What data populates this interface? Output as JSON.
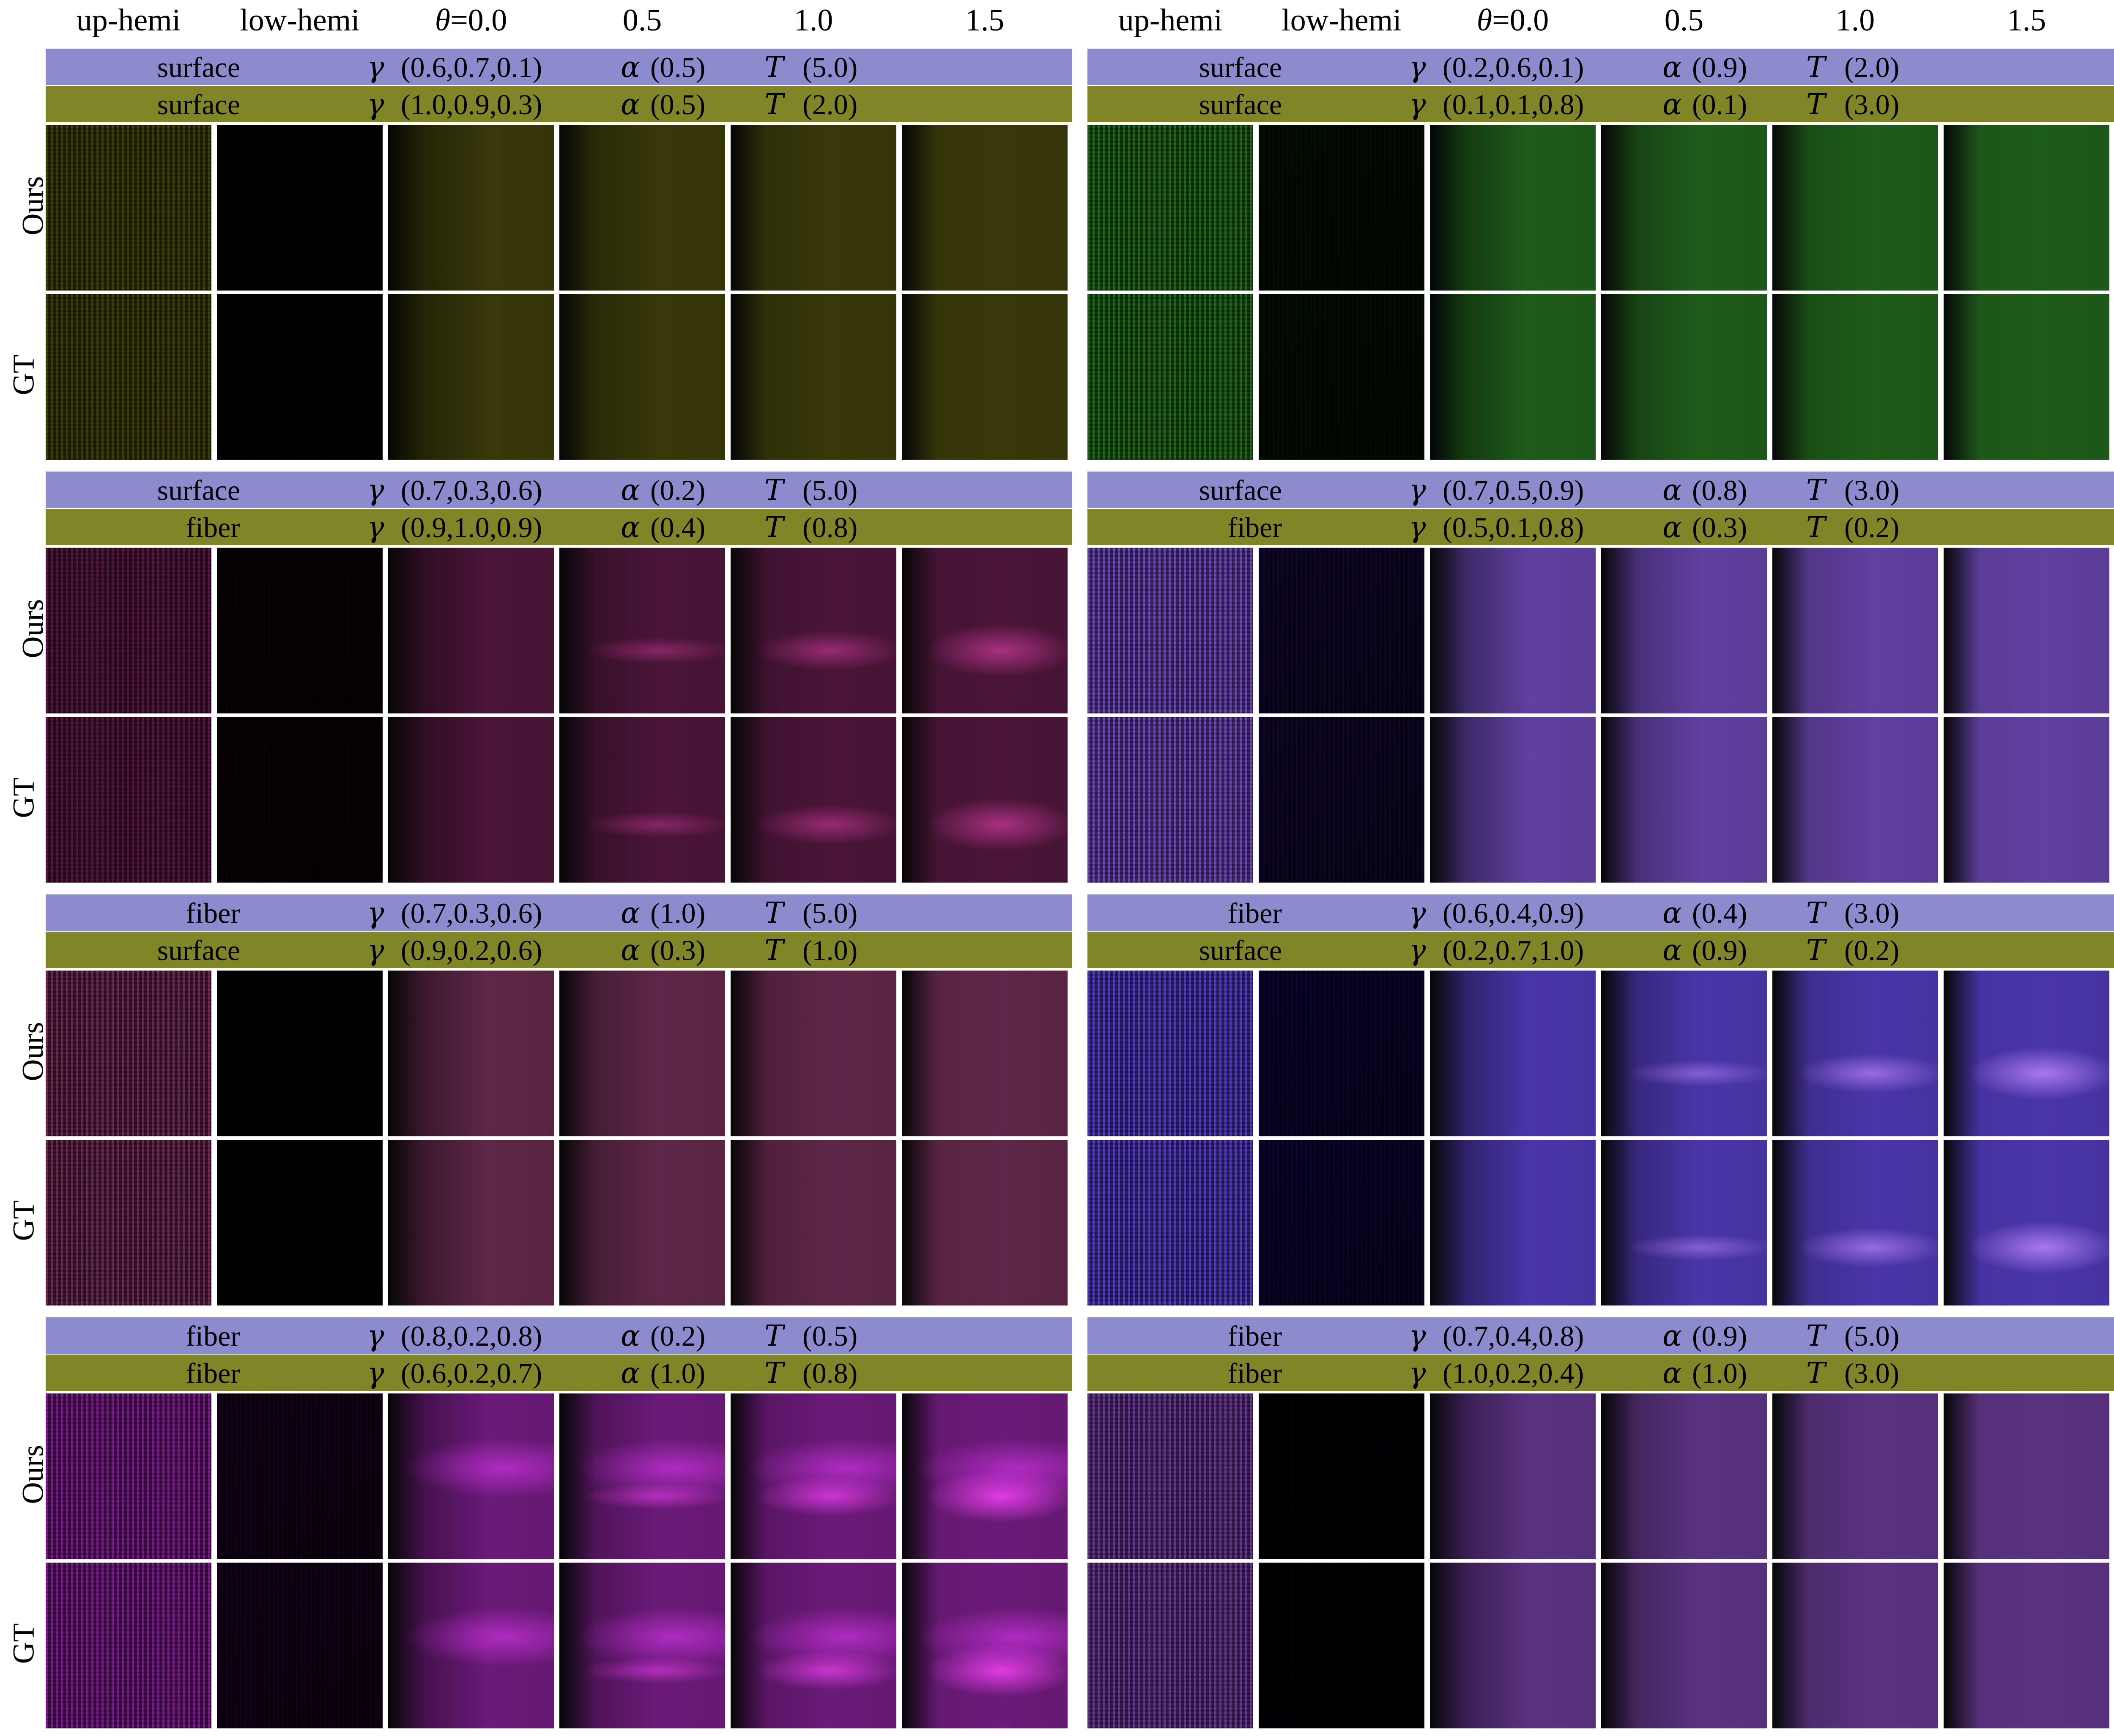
{
  "column_headers": {
    "up_hemi": "up-hemi",
    "low_hemi": "low-hemi",
    "theta_symbol": "θ",
    "theta_0": "=0.0",
    "theta_1": "0.5",
    "theta_2": "1.0",
    "theta_3": "1.5"
  },
  "row_labels": {
    "ours": "Ours",
    "gt": "GT"
  },
  "symbols": {
    "gamma": "γ",
    "alpha": "α",
    "T": "T"
  },
  "panels": [
    {
      "layers": [
        {
          "type": "surface",
          "gamma": "(0.6,0.7,0.1)",
          "alpha": "(0.5)",
          "T": "(5.0)"
        },
        {
          "type": "surface",
          "gamma": "(1.0,0.9,0.3)",
          "alpha": "(0.5)",
          "T": "(2.0)"
        }
      ],
      "color": "#38380a"
    },
    {
      "layers": [
        {
          "type": "surface",
          "gamma": "(0.2,0.6,0.1)",
          "alpha": "(0.9)",
          "T": "(2.0)"
        },
        {
          "type": "surface",
          "gamma": "(0.1,0.1,0.8)",
          "alpha": "(0.1)",
          "T": "(3.0)"
        }
      ],
      "color": "#1e5c1a"
    },
    {
      "layers": [
        {
          "type": "surface",
          "gamma": "(0.7,0.3,0.6)",
          "alpha": "(0.2)",
          "T": "(5.0)"
        },
        {
          "type": "fiber",
          "gamma": "(0.9,1.0,0.9)",
          "alpha": "(0.4)",
          "T": "(0.8)"
        }
      ],
      "color": "#4a1538"
    },
    {
      "layers": [
        {
          "type": "surface",
          "gamma": "(0.7,0.5,0.9)",
          "alpha": "(0.8)",
          "T": "(3.0)"
        },
        {
          "type": "fiber",
          "gamma": "(0.5,0.1,0.8)",
          "alpha": "(0.3)",
          "T": "(0.2)"
        }
      ],
      "color": "#6040a0"
    },
    {
      "layers": [
        {
          "type": "fiber",
          "gamma": "(0.7,0.3,0.6)",
          "alpha": "(1.0)",
          "T": "(5.0)"
        },
        {
          "type": "surface",
          "gamma": "(0.9,0.2,0.6)",
          "alpha": "(0.3)",
          "T": "(1.0)"
        }
      ],
      "color": "#5e2648"
    },
    {
      "layers": [
        {
          "type": "fiber",
          "gamma": "(0.6,0.4,0.9)",
          "alpha": "(0.4)",
          "T": "(3.0)"
        },
        {
          "type": "surface",
          "gamma": "(0.2,0.7,1.0)",
          "alpha": "(0.9)",
          "T": "(0.2)"
        }
      ],
      "color": "#4a35a8"
    },
    {
      "layers": [
        {
          "type": "fiber",
          "gamma": "(0.8,0.2,0.8)",
          "alpha": "(0.2)",
          "T": "(0.5)"
        },
        {
          "type": "fiber",
          "gamma": "(0.6,0.2,0.7)",
          "alpha": "(1.0)",
          "T": "(0.8)"
        }
      ],
      "color": "#6a1a78"
    },
    {
      "layers": [
        {
          "type": "fiber",
          "gamma": "(0.7,0.4,0.8)",
          "alpha": "(0.9)",
          "T": "(5.0)"
        },
        {
          "type": "fiber",
          "gamma": "(1.0,0.2,0.4)",
          "alpha": "(1.0)",
          "T": "(3.0)"
        }
      ],
      "color": "#5a3280"
    }
  ]
}
